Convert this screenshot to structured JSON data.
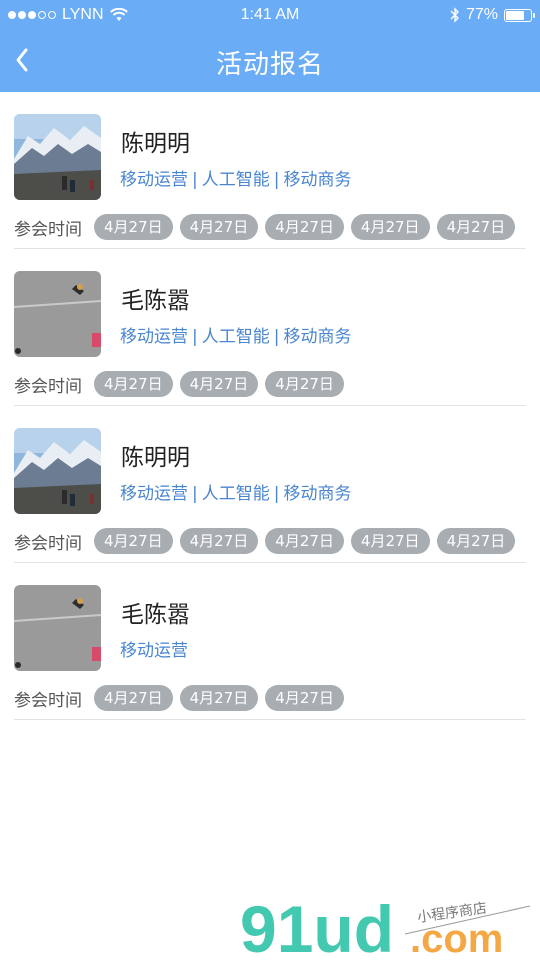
{
  "status_bar": {
    "carrier": "LYNN",
    "time": "1:41 AM",
    "battery": "77%",
    "battery_level": 0.77
  },
  "header": {
    "title": "活动报名"
  },
  "items": [
    {
      "name": "陈明明",
      "tags": [
        "移动运营",
        "人工智能",
        "移动商务"
      ],
      "time_label": "参会时间",
      "dates": [
        "4月27日",
        "4月27日",
        "4月27日",
        "4月27日",
        "4月27日"
      ],
      "thumb": "mountain"
    },
    {
      "name": "毛陈嚣",
      "tags": [
        "移动运营",
        "人工智能",
        "移动商务"
      ],
      "time_label": "参会时间",
      "dates": [
        "4月27日",
        "4月27日",
        "4月27日"
      ],
      "thumb": "pavement"
    },
    {
      "name": "陈明明",
      "tags": [
        "移动运营",
        "人工智能",
        "移动商务"
      ],
      "time_label": "参会时间",
      "dates": [
        "4月27日",
        "4月27日",
        "4月27日",
        "4月27日",
        "4月27日"
      ],
      "thumb": "mountain"
    },
    {
      "name": "毛陈嚣",
      "tags": [
        "移动运营"
      ],
      "time_label": "参会时间",
      "dates": [
        "4月27日",
        "4月27日",
        "4月27日"
      ],
      "thumb": "pavement"
    }
  ],
  "watermark": {
    "brand": "91ud",
    "domain": ".com",
    "tagline": "小程序商店"
  },
  "colors": {
    "header_bg": "#6aacf6",
    "tag_text": "#4a86cf",
    "chip_bg": "#a8adb2"
  }
}
